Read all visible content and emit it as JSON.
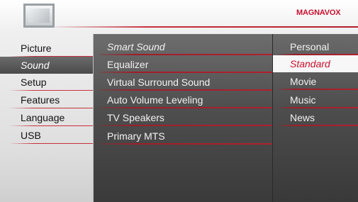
{
  "brand": "MAGNAVOX",
  "colors": {
    "accent_red": "#c8102e",
    "menu_dark": "#4e4e4e",
    "menu_light": "#efefef"
  },
  "header": {
    "icon": "tv-icon"
  },
  "main_menu": {
    "items": [
      {
        "label": "Picture",
        "selected": false
      },
      {
        "label": "Sound",
        "selected": true
      },
      {
        "label": "Setup",
        "selected": false
      },
      {
        "label": "Features",
        "selected": false
      },
      {
        "label": "Language",
        "selected": false
      },
      {
        "label": "USB",
        "selected": false
      }
    ]
  },
  "sound_menu": {
    "items": [
      {
        "label": "Smart Sound",
        "highlighted": true
      },
      {
        "label": "Equalizer"
      },
      {
        "label": "Virtual Surround Sound"
      },
      {
        "label": "Auto Volume Leveling"
      },
      {
        "label": "TV Speakers"
      },
      {
        "label": "Primary MTS"
      }
    ]
  },
  "smart_sound_options": {
    "items": [
      {
        "label": "Personal",
        "selected": false
      },
      {
        "label": "Standard",
        "selected": true
      },
      {
        "label": "Movie",
        "selected": false
      },
      {
        "label": "Music",
        "selected": false
      },
      {
        "label": "News",
        "selected": false
      }
    ]
  }
}
